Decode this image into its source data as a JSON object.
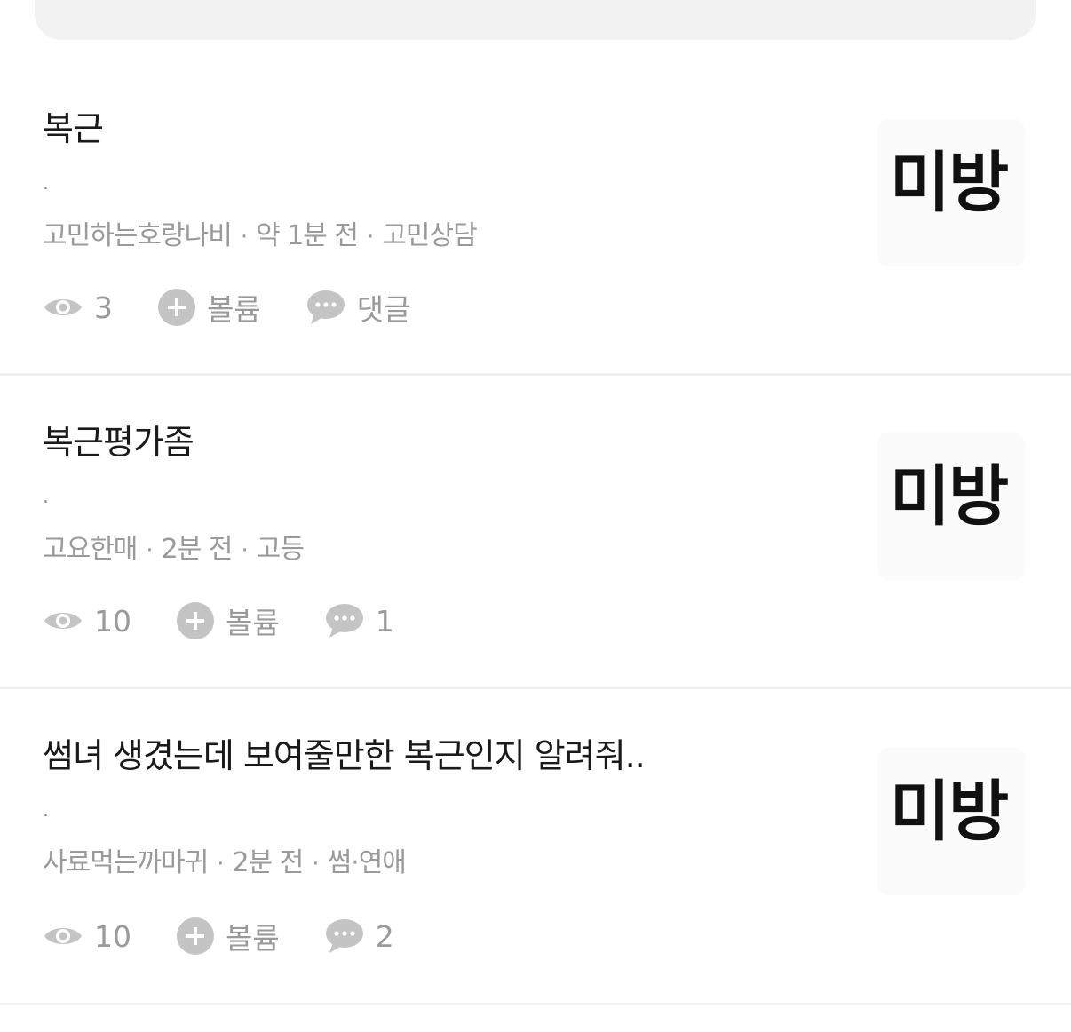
{
  "posts": [
    {
      "title": "복근",
      "body": ".",
      "author": "고민하는호랑나비",
      "time": "약 1분 전",
      "board": "고민상담",
      "views": "3",
      "volume_label": "볼륨",
      "comments": "댓글",
      "thumbnail_text": "미방"
    },
    {
      "title": "복근평가좀",
      "body": ".",
      "author": "고요한매",
      "time": "2분 전",
      "board": "고등",
      "views": "10",
      "volume_label": "볼륨",
      "comments": "1",
      "thumbnail_text": "미방"
    },
    {
      "title": "썸녀 생겼는데 보여줄만한 복근인지 알려줘..",
      "body": ".",
      "author": "사료먹는까마귀",
      "time": "2분 전",
      "board": "썸·연애",
      "views": "10",
      "volume_label": "볼륨",
      "comments": "2",
      "thumbnail_text": "미방"
    }
  ],
  "meta_separator": "·",
  "colors": {
    "title": "#1a1a1a",
    "meta": "#9a9a9a",
    "icon": "#c4c4c4",
    "divider": "#eeeeee",
    "search_bg": "#f2f2f2"
  },
  "icons": {
    "views": "eye-icon",
    "volume": "plus-circle-icon",
    "comments": "speech-bubble-icon"
  }
}
